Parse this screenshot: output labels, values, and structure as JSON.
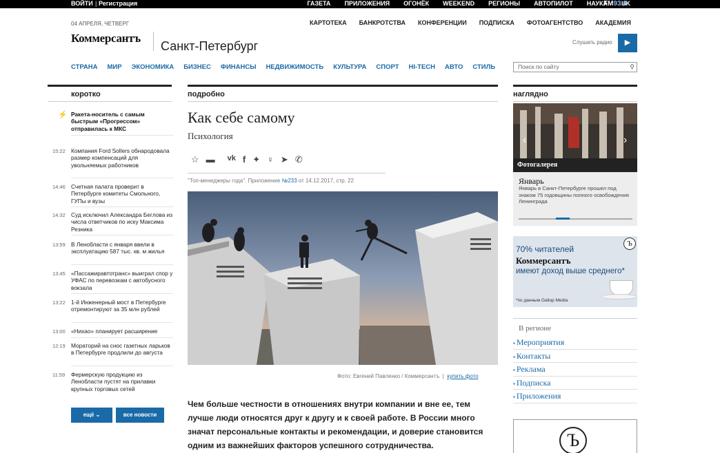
{
  "topbar": {
    "login": "ВОЙТИ",
    "register": "Регистрация",
    "nav": [
      "ГАЗЕТА",
      "ПРИЛОЖЕНИЯ",
      "ОГОНЁК",
      "WEEKEND",
      "РЕГИОНЫ",
      "АВТОПИЛОТ",
      "НАУКА",
      "UK"
    ],
    "fm": "FM",
    "fm_freq": "93.6"
  },
  "header": {
    "date": "04 АПРЕЛЯ, ЧЕТВЕРГ",
    "secondary_nav": [
      "КАРТОТЕКА",
      "БАНКРОТСТВА",
      "КОНФЕРЕНЦИИ",
      "ПОДПИСКА",
      "ФОТОАГЕНТСТВО",
      "АКАДЕМИЯ"
    ],
    "logo": "Коммерсантъ",
    "city": "Санкт-Петербург",
    "radio_label": "Слушать радио"
  },
  "main_nav": [
    "СТРАНА",
    "МИР",
    "ЭКОНОМИКА",
    "БИЗНЕС",
    "ФИНАНСЫ",
    "НЕДВИЖИМОСТЬ",
    "КУЛЬТУРА",
    "СПОРТ",
    "HI-TECH",
    "АВТО",
    "СТИЛЬ"
  ],
  "search": {
    "placeholder": "Поиск по сайту"
  },
  "columns": {
    "left": "коротко",
    "center": "подробно",
    "right": "наглядно"
  },
  "news": [
    {
      "time": "",
      "text": "Ракета-носитель с самым быстрым «Прогрессом» отправилась к МКС",
      "bold": true
    },
    {
      "time": "15:22",
      "text": "Компания Ford Sollers обнародовала размер компенсаций для увольняемых работников"
    },
    {
      "time": "14:46",
      "text": "Счетная палата проверит в Петербурге комитеты Смольного, ГУПы и вузы"
    },
    {
      "time": "14:32",
      "text": "Суд исключил Александра Беглова из числа ответчиков по иску Максима Резника"
    },
    {
      "time": "13:59",
      "text": "В Ленобласти с января ввели в эксплуатацию 587 тыс. кв. м жилья"
    },
    {
      "time": "13:45",
      "text": "«Пассажиравтотранс» выиграл спор у УФАС по перевозкам с автобусного вокзала"
    },
    {
      "time": "13:22",
      "text": "1-й Инженерный мост в Петербурге отремонтируют за 35 млн рублей"
    },
    {
      "time": "13:00",
      "text": "«Нихао» планирует расширение"
    },
    {
      "time": "12:19",
      "text": "Мораторий на снос газетных ларьков в Петербурге продлили до августа"
    },
    {
      "time": "11:59",
      "text": "Фермерскую продукцию из Ленобласти пустят на прилавки крупных торговых сетей"
    }
  ],
  "buttons": {
    "more": "ещё",
    "all_news": "все новости"
  },
  "article": {
    "title": "Как себе самому",
    "subtitle": "Психология",
    "source_prefix": "\"Топ-менеджеры года\". Приложение ",
    "source_issue": "№233",
    "source_suffix": " от 14.12.2017, стр. 22",
    "photo_credit": "Фото: Евгений Павленко / Коммерсантъ",
    "buy_photo": "купить фото",
    "lead": "Чем больше честности в отношениях внутри компании и вне ее, тем лучше люди относятся друг к другу и к своей работе. В России много значат персональные контакты и рекомендации, и доверие становится одним из важнейших факторов успешного сотрудничества."
  },
  "gallery": {
    "label": "Фотогалерея",
    "title": "Январь",
    "text": "Январь в Санкт-Петербурге прошел под знаком 75 годовщины полного освобождения Ленинграда"
  },
  "ad": {
    "line1": "70% читателей",
    "line2": "Коммерсантъ",
    "line3": "имеют доход выше среднего*",
    "footnote": "*по данным Gallup Media"
  },
  "region": {
    "heading": "В регионе",
    "links": [
      "Мероприятия",
      "Контакты",
      "Реклама",
      "Подписка",
      "Приложения"
    ]
  }
}
